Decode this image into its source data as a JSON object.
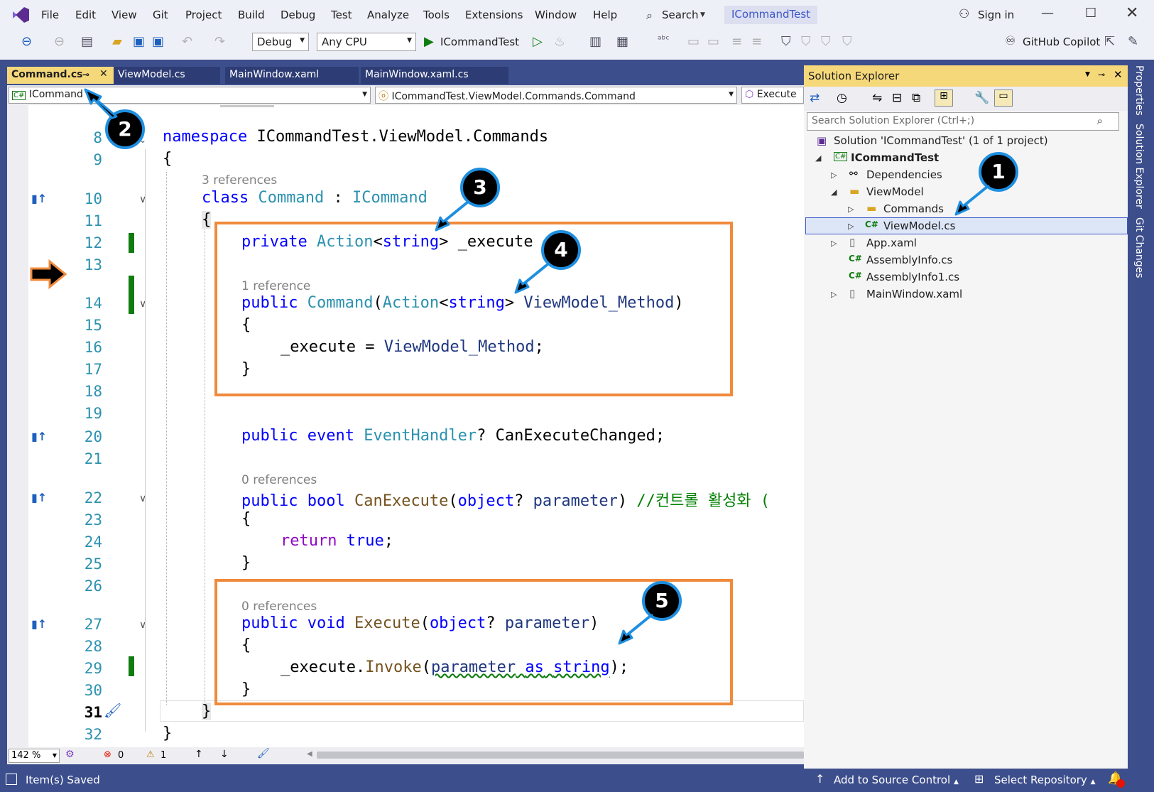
{
  "menu": [
    "File",
    "Edit",
    "View",
    "Git",
    "Project",
    "Build",
    "Debug",
    "Test",
    "Analyze",
    "Tools",
    "Extensions",
    "Window",
    "Help"
  ],
  "search_label": "Search",
  "app_title": "ICommandTest",
  "signin": "Sign in",
  "toolbar": {
    "config": "Debug",
    "platform": "Any CPU",
    "run_target": "ICommandTest",
    "copilot": "GitHub Copilot"
  },
  "doc_tabs": [
    "Command.cs",
    "ViewModel.cs",
    "MainWindow.xaml",
    "MainWindow.xaml.cs"
  ],
  "navbar": {
    "project": "ICommand",
    "type": "ICommandTest.ViewModel.Commands.Command",
    "member": "Execute"
  },
  "line_numbers": [
    "8",
    "9",
    "10",
    "11",
    "12",
    "13",
    "14",
    "15",
    "16",
    "17",
    "18",
    "19",
    "20",
    "21",
    "22",
    "23",
    "24",
    "25",
    "26",
    "27",
    "28",
    "29",
    "30",
    "31",
    "32"
  ],
  "code": {
    "l8_kw": "namespace",
    "l8_name": "ICommandTest.ViewModel.Commands",
    "brace_open": "{",
    "brace_close": "}",
    "refs_3": "3 references",
    "refs_1": "1 reference",
    "refs_0": "0 references",
    "kw_class": "class",
    "cls_command": "Command",
    "colon": ":",
    "iface": "ICommand",
    "kw_private": "private",
    "ty_action": "Action",
    "lt": "<",
    "kw_string": "string",
    "gt": ">",
    "field_execute": "_execute",
    "kw_public": "public",
    "ctor_command": "Command",
    "paren_open": "(",
    "param_vm": "ViewModel_Method",
    "paren_close": ")",
    "assign_lhs": "_execute",
    "assign_eq": "=",
    "assign_semicolon": ";",
    "kw_event": "event",
    "ty_eventhandler": "EventHandler",
    "q": "?",
    "evt_name": "CanExecuteChanged",
    "kw_bool": "bool",
    "fn_canexecute": "CanExecute",
    "kw_object": "object",
    "param_parameter": "parameter",
    "comment_kr": "//컨트롤 활성화 (",
    "kw_return": "return",
    "kw_true": "true",
    "kw_void": "void",
    "fn_execute": "Execute",
    "invoke_fn": "Invoke",
    "kw_as": "as",
    "dot": "."
  },
  "editor_status": {
    "zoom": "142 %",
    "errors": "0",
    "warnings": "1"
  },
  "status": {
    "saved": "Item(s) Saved",
    "source_control": "Add to Source Control",
    "repo": "Select Repository"
  },
  "solution_explorer": {
    "title": "Solution Explorer",
    "search_placeholder": "Search Solution Explorer (Ctrl+;)",
    "solution": "Solution 'ICommandTest' (1 of 1 project)",
    "project": "ICommandTest",
    "dependencies": "Dependencies",
    "viewmodel_folder": "ViewModel",
    "commands_folder": "Commands",
    "viewmodel_cs": "ViewModel.cs",
    "app_xaml": "App.xaml",
    "assemblyinfo": "AssemblyInfo.cs",
    "assemblyinfo1": "AssemblyInfo1.cs",
    "mainwindow": "MainWindow.xaml"
  },
  "side_tabs": [
    "Properties",
    "Solution Explorer",
    "Git Changes"
  ],
  "badges": [
    "1",
    "2",
    "3",
    "4",
    "5"
  ],
  "colors": {
    "accent_frame": "#3d4e8c",
    "tab_active": "#f5d87a",
    "annotation_box": "#f08a3c",
    "badge_ring": "#1e8fe0"
  }
}
